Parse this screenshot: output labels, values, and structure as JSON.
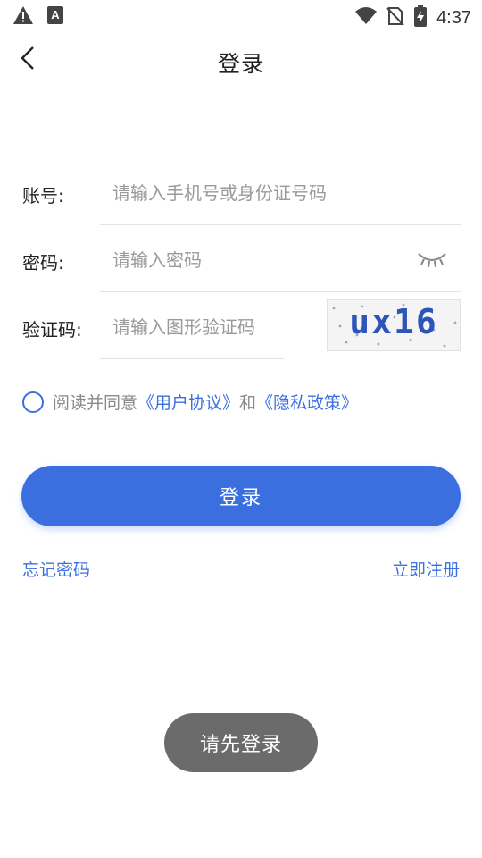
{
  "status_bar": {
    "time": "4:37",
    "left_icons": [
      "warning-icon",
      "font-icon"
    ],
    "right_icons": [
      "wifi-icon",
      "no-sim-icon",
      "battery-charging-icon"
    ]
  },
  "header": {
    "title": "登录",
    "back_icon": "chevron-left-icon"
  },
  "form": {
    "account": {
      "label": "账号:",
      "placeholder": "请输入手机号或身份证号码",
      "value": ""
    },
    "password": {
      "label": "密码:",
      "placeholder": "请输入密码",
      "value": "",
      "toggle_icon": "eye-closed-icon"
    },
    "captcha": {
      "label": "验证码:",
      "placeholder": "请输入图形验证码",
      "value": "",
      "image_text": "ux16"
    }
  },
  "agreement": {
    "prefix": "阅读并同意",
    "user_agreement": "《用户协议》",
    "conjunction": "和",
    "privacy_policy": "《隐私政策》",
    "checked": false
  },
  "login_button": "登录",
  "links": {
    "forgot_password": "忘记密码",
    "register": "立即注册"
  },
  "toast": "请先登录",
  "colors": {
    "accent": "#3b6fe0",
    "toast_bg": "#6b6b6b",
    "placeholder": "#9a9a9a",
    "divider": "#e4e4e4"
  }
}
